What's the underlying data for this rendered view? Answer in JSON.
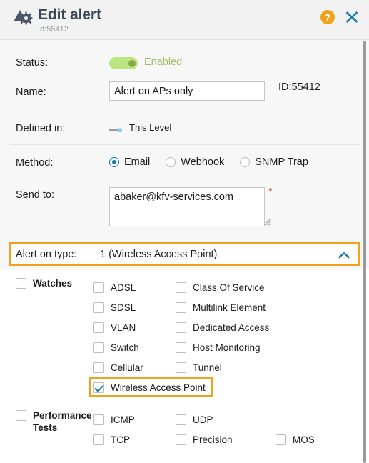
{
  "header": {
    "title": "Edit alert",
    "sub_id": "Id:55412",
    "help_label": "?",
    "icon": "alert-gear-icon",
    "close_icon": "close-icon",
    "accent_orange": "#efa31d",
    "accent_blue": "#1a79b4"
  },
  "form": {
    "status": {
      "label": "Status:",
      "toggle_state": "on",
      "value_text": "Enabled"
    },
    "name": {
      "label": "Name:",
      "value": "Alert on APs only",
      "placeholder": "",
      "id_text": "ID:55412"
    },
    "defined_in": {
      "label": "Defined in:",
      "value": "This Level",
      "icon": "hierarchy-level-icon"
    },
    "method": {
      "label": "Method:",
      "options": [
        {
          "label": "Email",
          "selected": true
        },
        {
          "label": "Webhook",
          "selected": false
        },
        {
          "label": "SNMP Trap",
          "selected": false
        }
      ]
    },
    "send_to": {
      "label": "Send to:",
      "value": "abaker@kfv-services.com",
      "placeholder": "",
      "required_marker": "*"
    }
  },
  "accordion": {
    "label": "Alert on type:",
    "value": "1 (Wireless Access Point)",
    "expanded": true,
    "chevron_icon": "chevron-up-icon",
    "highlighted": true
  },
  "sections": [
    {
      "group_label": "Watches",
      "group_checked": false,
      "rows": [
        [
          {
            "label": "ADSL",
            "checked": false,
            "highlighted": false
          },
          {
            "label": "Class Of Service",
            "checked": false,
            "highlighted": false
          }
        ],
        [
          {
            "label": "SDSL",
            "checked": false,
            "highlighted": false
          },
          {
            "label": "Multilink Element",
            "checked": false,
            "highlighted": false
          }
        ],
        [
          {
            "label": "VLAN",
            "checked": false,
            "highlighted": false
          },
          {
            "label": "Dedicated Access",
            "checked": false,
            "highlighted": false
          }
        ],
        [
          {
            "label": "Switch",
            "checked": false,
            "highlighted": false
          },
          {
            "label": "Host Monitoring",
            "checked": false,
            "highlighted": false
          }
        ],
        [
          {
            "label": "Cellular",
            "checked": false,
            "highlighted": false
          },
          {
            "label": "Tunnel",
            "checked": false,
            "highlighted": false
          }
        ],
        [
          {
            "label": "Wireless Access Point",
            "checked": true,
            "highlighted": true
          }
        ]
      ]
    },
    {
      "group_label": "Performance Tests",
      "group_checked": false,
      "rows": [
        [
          {
            "label": "ICMP",
            "checked": false,
            "highlighted": false
          },
          {
            "label": "UDP",
            "checked": false,
            "highlighted": false
          }
        ],
        [
          {
            "label": "TCP",
            "checked": false,
            "highlighted": false
          },
          {
            "label": "Precision",
            "checked": false,
            "highlighted": false
          },
          {
            "label": "MOS",
            "checked": false,
            "highlighted": false
          }
        ]
      ]
    }
  ]
}
